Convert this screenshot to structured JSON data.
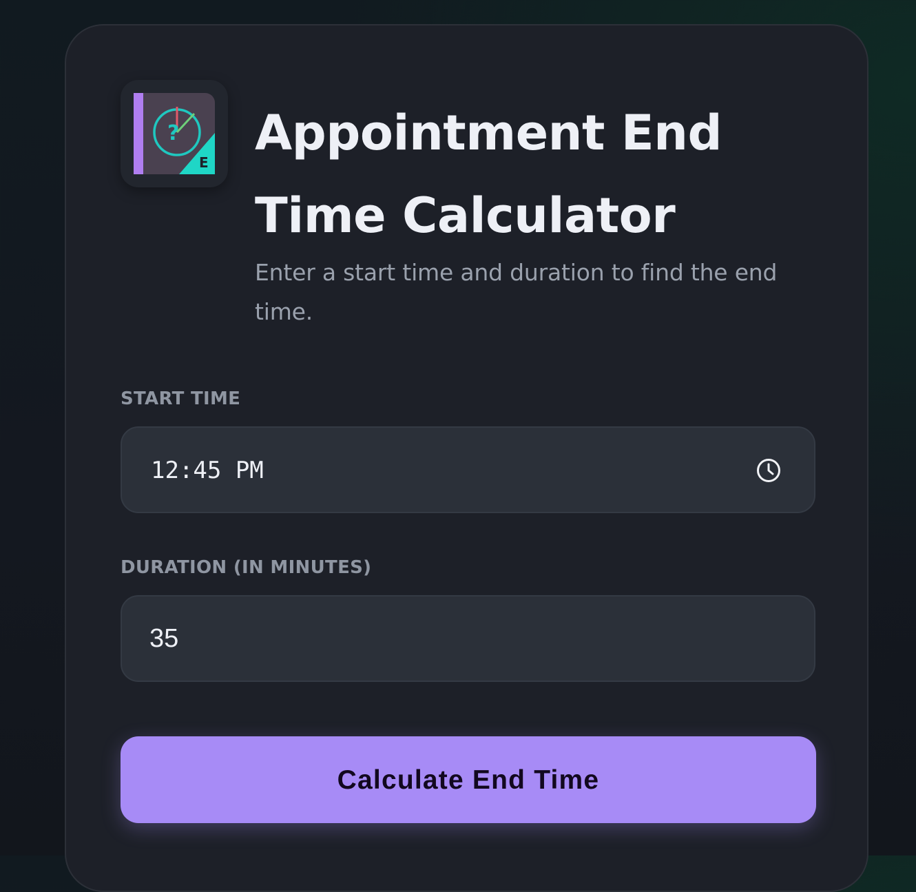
{
  "header": {
    "logo": {
      "icon": "clock-question-logo-icon",
      "badge_letter": "E",
      "question_mark": "?",
      "colors": {
        "purple": "#b07ef0",
        "teal": "#1fd6c6",
        "tile": "#4a4150",
        "red_hand": "#e05a6a",
        "green_hand": "#6ecf7a"
      }
    },
    "title": "Appointment End Time Calculator",
    "subtitle": "Enter a start time and duration to find the end time."
  },
  "form": {
    "start_time": {
      "label": "START TIME",
      "value": "12:45 PM",
      "icon": "clock-icon"
    },
    "duration": {
      "label": "DURATION (IN MINUTES)",
      "value": "35"
    },
    "submit_label": "Calculate End Time"
  },
  "colors": {
    "background": "#141820",
    "card": "#1d2028",
    "input": "#2b3039",
    "accent": "#a78bf6",
    "text_primary": "#eef0f6",
    "text_muted": "#9aa1ad"
  }
}
